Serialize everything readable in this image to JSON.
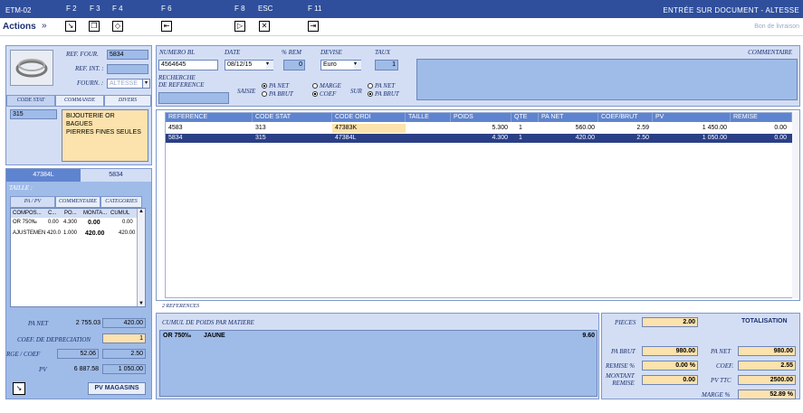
{
  "topbar": {
    "code": "ETM-02",
    "keys": [
      "F 2",
      "F 3",
      "F 4",
      "F 6",
      "F 8",
      "ESC",
      "F 11"
    ],
    "title": "ENTRÉE SUR DOCUMENT - ALTESSE"
  },
  "toolbar": {
    "actions": "Actions",
    "doc_type": "Bon de livraison"
  },
  "left": {
    "ref_four_label": "REF. FOUR.",
    "ref_four_value": "5834",
    "ref_int_label": "REF. INT. :",
    "ref_int_value": "",
    "fourn_label": "FOURN. :",
    "fourn_value": "ALTESSE",
    "tabs": [
      "CODE STAT",
      "COMMANDE",
      "DIVERS"
    ],
    "code_stat": "315",
    "desc_lines": [
      "BIJOUTERIE OR",
      "BAGUES",
      "PIERRES FINES SEULES"
    ],
    "item_tabs": [
      "47384L",
      "5834"
    ],
    "taille_label": "TAILLE :",
    "sub_tabs": [
      "PA / PV",
      "COMMENTAIRE",
      "CATEGORIES"
    ],
    "comp_headers": [
      "COMPOS...",
      "C...",
      "PO...",
      "MONTA...",
      "CUMUL"
    ],
    "comp_rows": [
      {
        "name": "OR 750‰",
        "c": "0.00",
        "po": "4.300",
        "monta": "0.00",
        "cumul": "0.00"
      },
      {
        "name": "AJUSTEMEN",
        "c": "420.0",
        "po": "1.000",
        "monta": "420.00",
        "cumul": "420.00"
      }
    ],
    "pa_net_label": "PA NET",
    "pa_net_a": "2 755.03",
    "pa_net_b": "420.00",
    "coef_dep_label": "COEF. DE DEPRECIATION",
    "coef_dep_value": "1",
    "marge_coef_label": "RGE / COEF",
    "marge_coef_a": "52.06",
    "marge_coef_b": "2.50",
    "pv_label": "PV",
    "pv_a": "6 887.58",
    "pv_b": "1 050.00",
    "pv_magasins": "PV MAGASINS"
  },
  "header": {
    "numero_bl_label": "NUMERO BL",
    "numero_bl_value": "4564645",
    "date_label": "DATE",
    "date_value": "08/12/15",
    "rem_label": "% REM",
    "rem_value": "0",
    "devise_label": "DEVISE",
    "devise_value": "Euro",
    "taux_label": "TAUX",
    "taux_value": "1",
    "commentaire_label": "COMMENTAIRE",
    "recherche_label": "RECHERCHE\nDE REFERENCE",
    "saisie_label": "SAISIE",
    "sur_label": "SUR",
    "opt_pa_net": "PA NET",
    "opt_pa_brut": "PA BRUT",
    "opt_marge": "MARGE",
    "opt_coef": "COEF",
    "opt_sur_pa_net": "PA NET",
    "opt_sur_pa_brut": "PA BRUT"
  },
  "table": {
    "headers": [
      "REFERENCE",
      "CODE STAT",
      "CODE ORDI",
      "TAILLE",
      "POIDS",
      "QTE",
      "PA NET",
      "COEF/BRUT",
      "PV",
      "REMISE"
    ],
    "rows": [
      {
        "reference": "4583",
        "code_stat": "313",
        "code_ordi": "47383K",
        "taille": "",
        "poids": "5.300",
        "qte": "1",
        "pa_net": "560.00",
        "coef": "2.59",
        "pv": "1 450.00",
        "remise": "0.00"
      },
      {
        "reference": "5834",
        "code_stat": "315",
        "code_ordi": "47384L",
        "taille": "",
        "poids": "4.300",
        "qte": "1",
        "pa_net": "420.00",
        "coef": "2.50",
        "pv": "1 050.00",
        "remise": "0.00"
      }
    ],
    "count": "2 REFERENCES"
  },
  "cumul": {
    "title": "CUMUL DE POIDS PAR MATIERE",
    "row_name": "OR 750‰",
    "row_color": "JAUNE",
    "row_value": "9.60"
  },
  "totals": {
    "pieces_label": "PIECES",
    "pieces_value": "2.00",
    "totalisation": "TOTALISATION",
    "pa_brut_label": "PA BRUT",
    "pa_brut_value": "980.00",
    "pa_net_label": "PA NET",
    "pa_net_value": "980.00",
    "remise_label": "REMISE %",
    "remise_value": "0.00 %",
    "coef_label": "COEF.",
    "coef_value": "2.55",
    "montant_label": "MONTANT\nREMISE",
    "montant_value": "0.00",
    "pv_ttc_label": "PV TTC",
    "pv_ttc_value": "2500.00",
    "marge_label": "MARGE %",
    "marge_value": "52.89 %"
  }
}
